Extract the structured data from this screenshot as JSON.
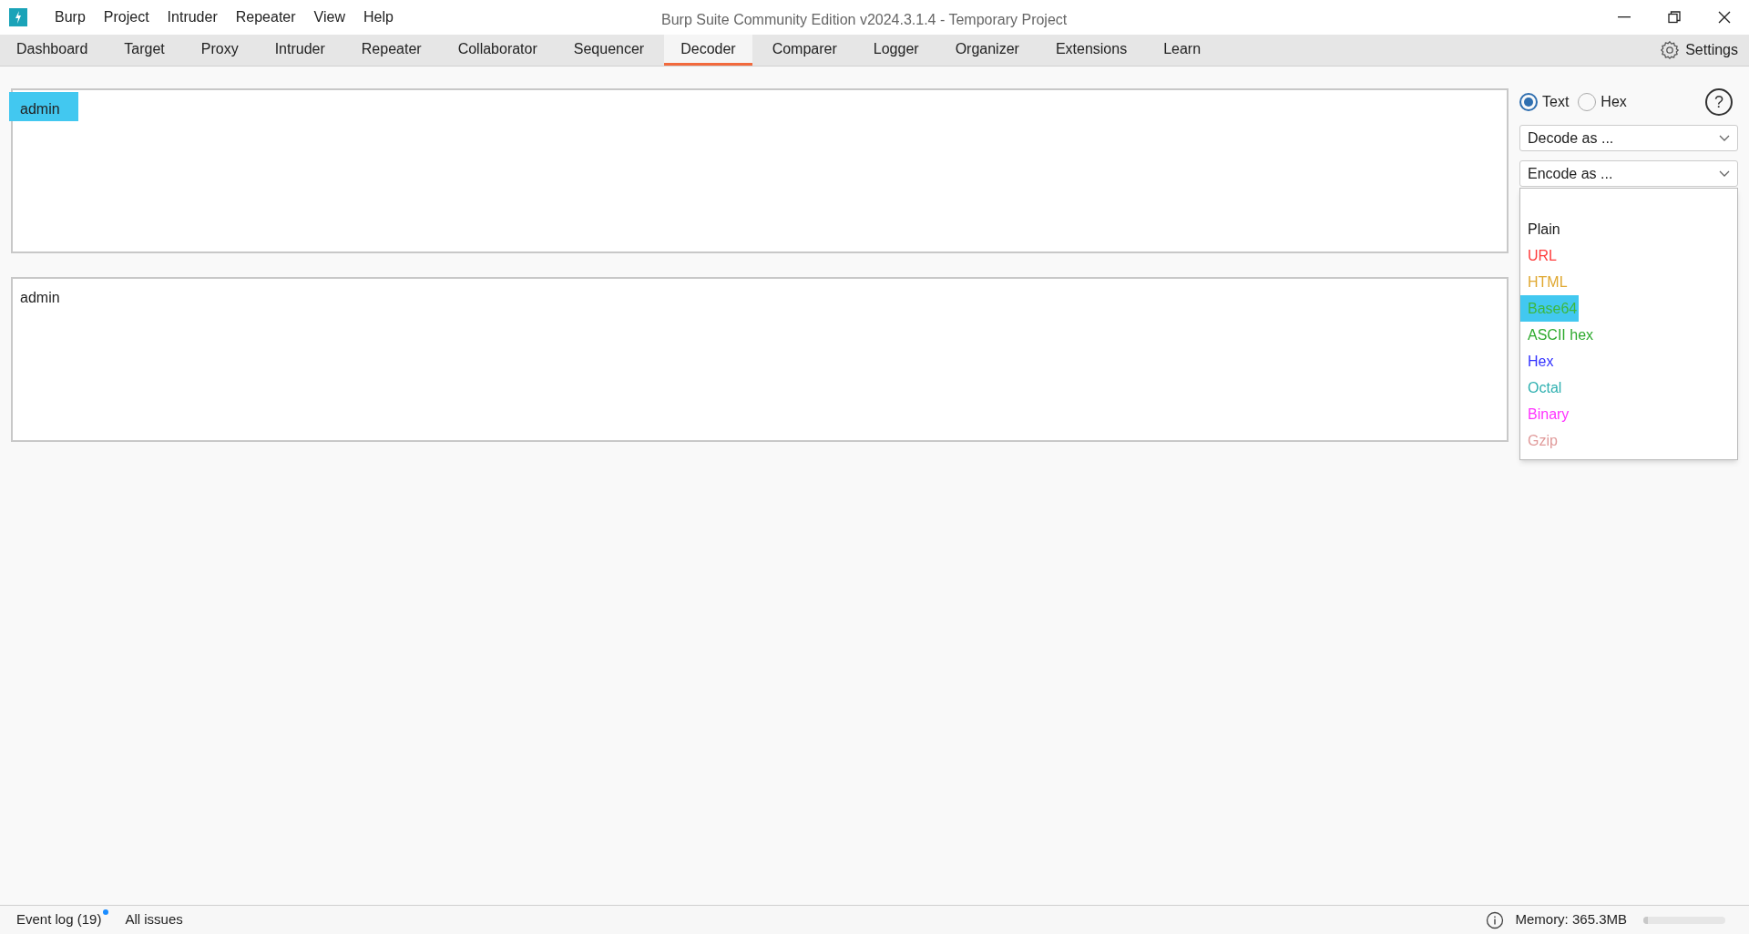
{
  "window": {
    "title": "Burp Suite Community Edition v2024.3.1.4 - Temporary Project"
  },
  "menu": [
    "Burp",
    "Project",
    "Intruder",
    "Repeater",
    "View",
    "Help"
  ],
  "tabs": [
    {
      "label": "Dashboard",
      "selected": false
    },
    {
      "label": "Target",
      "selected": false
    },
    {
      "label": "Proxy",
      "selected": false
    },
    {
      "label": "Intruder",
      "selected": false
    },
    {
      "label": "Repeater",
      "selected": false
    },
    {
      "label": "Collaborator",
      "selected": false
    },
    {
      "label": "Sequencer",
      "selected": false
    },
    {
      "label": "Decoder",
      "selected": true
    },
    {
      "label": "Comparer",
      "selected": false
    },
    {
      "label": "Logger",
      "selected": false
    },
    {
      "label": "Organizer",
      "selected": false
    },
    {
      "label": "Extensions",
      "selected": false
    },
    {
      "label": "Learn",
      "selected": false
    }
  ],
  "settings": "Settings",
  "panels": [
    {
      "text": "admin",
      "highlighted": true
    },
    {
      "text": "admin",
      "highlighted": false
    }
  ],
  "mode": [
    {
      "label": "Text",
      "selected": true
    },
    {
      "label": "Hex",
      "selected": false
    }
  ],
  "decode_dropdown": "Decode as ...",
  "encode_dropdown": "Encode as ...",
  "encode_options": [
    {
      "label": "Plain",
      "color": "#1a1a1a",
      "highlighted": false
    },
    {
      "label": "URL",
      "color": "#ff3b3b",
      "highlighted": false
    },
    {
      "label": "HTML",
      "color": "#e0a830",
      "highlighted": false
    },
    {
      "label": "Base64",
      "color": "#3cb83c",
      "highlighted": true
    },
    {
      "label": "ASCII hex",
      "color": "#2eaa2e",
      "highlighted": false
    },
    {
      "label": "Hex",
      "color": "#3333ff",
      "highlighted": false
    },
    {
      "label": "Octal",
      "color": "#2eb0b0",
      "highlighted": false
    },
    {
      "label": "Binary",
      "color": "#ff33ff",
      "highlighted": false
    },
    {
      "label": "Gzip",
      "color": "#e09a9a",
      "highlighted": false
    }
  ],
  "status_bar": {
    "event_log": "Event log (19)",
    "event_log_unread": true,
    "all_issues": "All issues",
    "memory": "Memory: 365.3MB",
    "memory_bar": {
      "level": 0.05
    }
  },
  "help": "?"
}
